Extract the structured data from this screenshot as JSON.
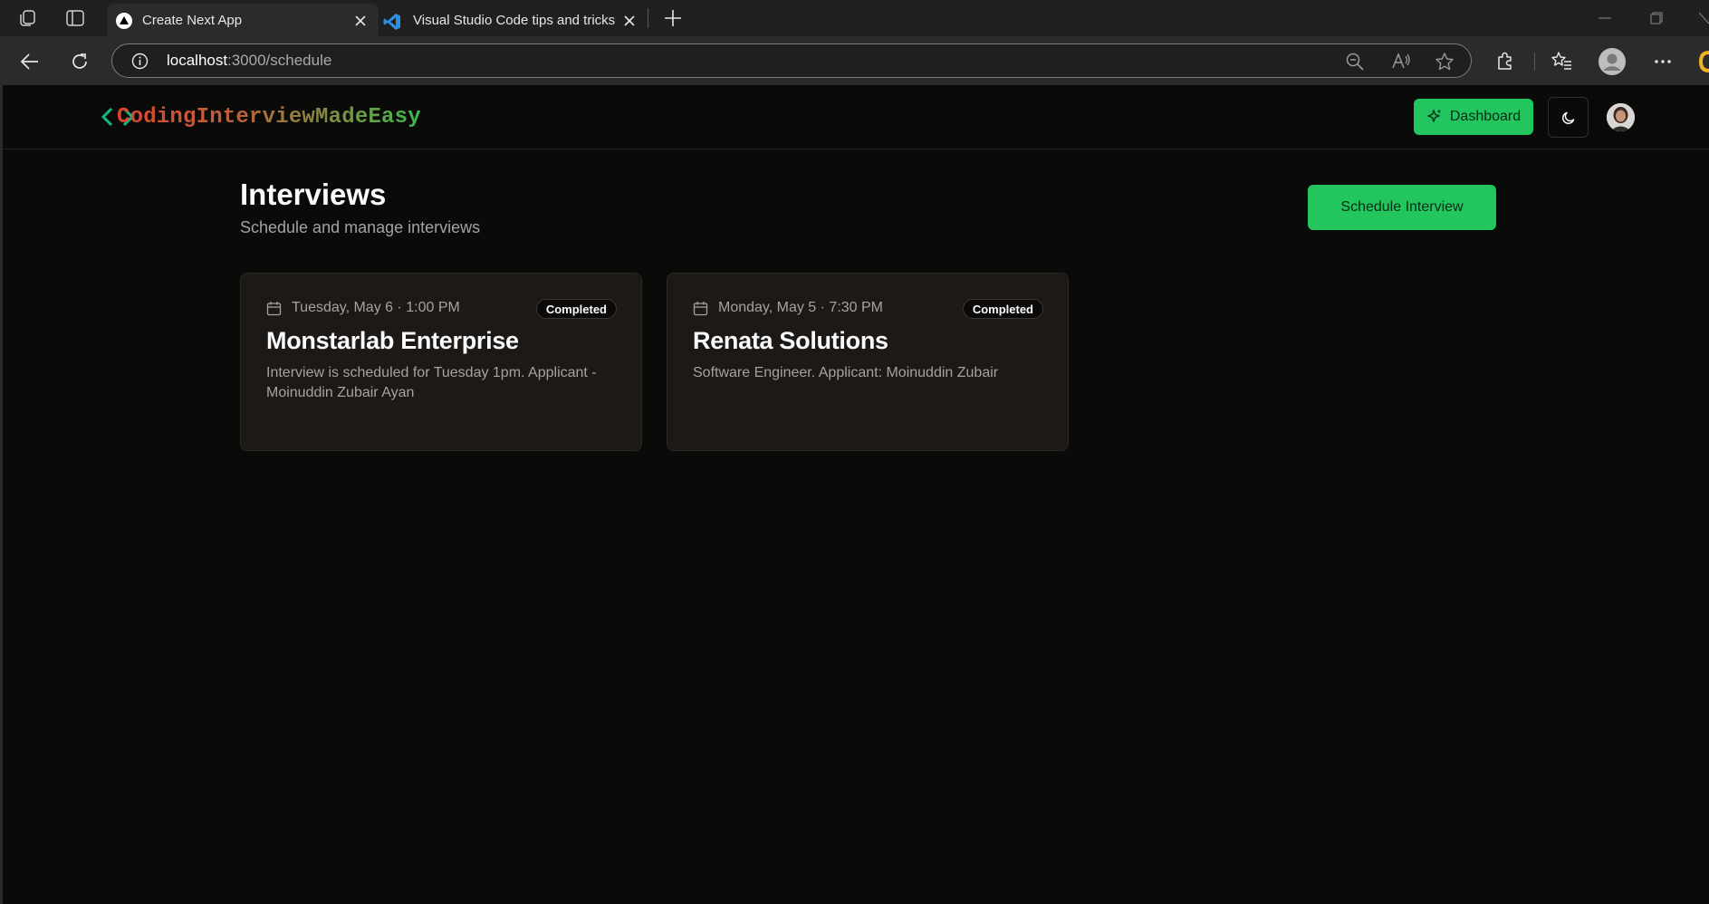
{
  "browser": {
    "tabs": [
      {
        "title": "Create Next App",
        "active": true
      },
      {
        "title": "Visual Studio Code tips and tricks",
        "active": false
      }
    ],
    "url_host": "localhost",
    "url_path": ":3000/schedule"
  },
  "app": {
    "logo_text": "CodingInterviewMadeEasy",
    "dashboard_label": "Dashboard",
    "colors": {
      "accent": "#22c55e",
      "background": "#0a0a09",
      "card": "#1c1917"
    }
  },
  "page": {
    "title": "Interviews",
    "subtitle": "Schedule and manage interviews",
    "schedule_button": "Schedule Interview"
  },
  "interviews": [
    {
      "date": "Tuesday, May 6 · 1:00 PM",
      "status": "Completed",
      "title": "Monstarlab Enterprise",
      "description": "Interview is scheduled for Tuesday 1pm. Applicant - Moinuddin Zubair Ayan"
    },
    {
      "date": "Monday, May 5 · 7:30 PM",
      "status": "Completed",
      "title": "Renata Solutions",
      "description": "Software Engineer. Applicant: Moinuddin Zubair"
    }
  ]
}
